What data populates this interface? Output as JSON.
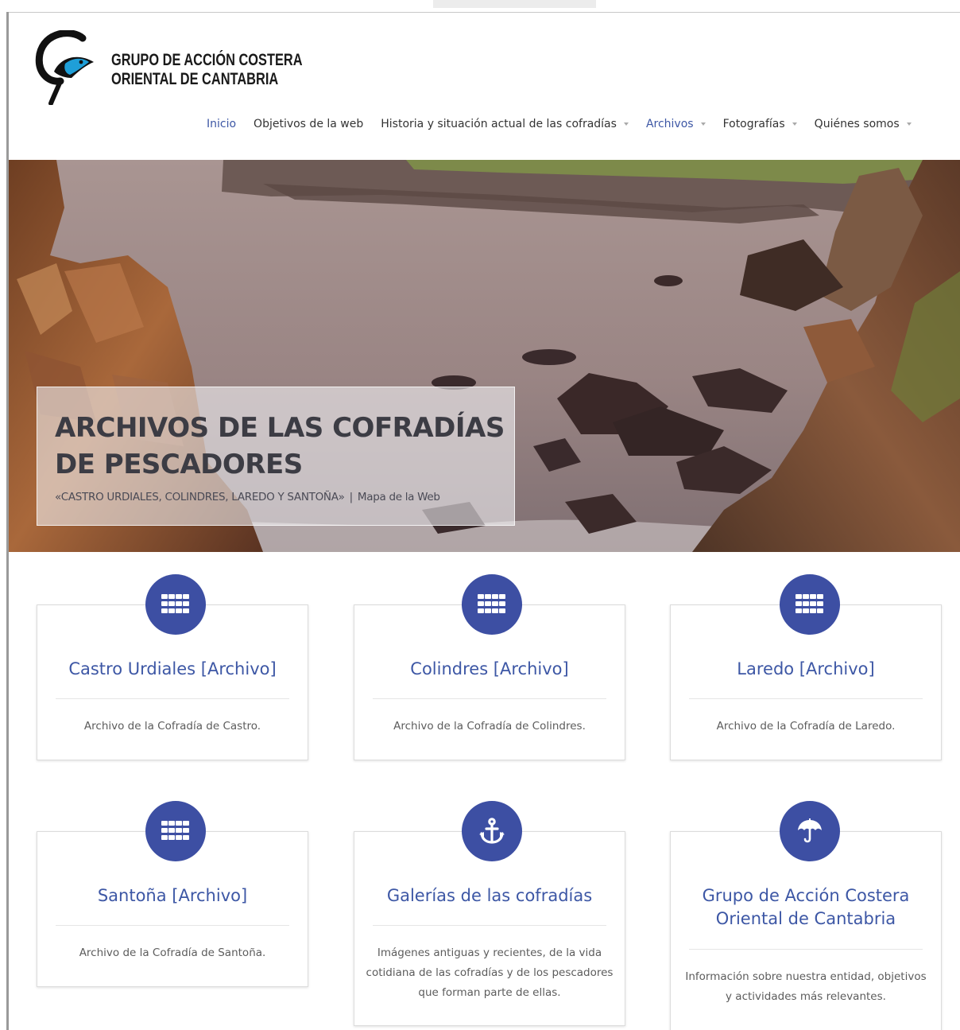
{
  "site": {
    "brand_line1": "GRUPO DE ACCIÓN COSTERA",
    "brand_line2": "ORIENTAL DE CANTABRIA",
    "logo_icon": "fish-logo-icon",
    "accent_color": "#3d57a5",
    "icon_bg_color": "#3d4fa3"
  },
  "nav": {
    "items": [
      {
        "label": "Inicio",
        "active": true,
        "dropdown": false
      },
      {
        "label": "Objetivos de la web",
        "active": false,
        "dropdown": false
      },
      {
        "label": "Historia y situación actual de las cofradías",
        "active": false,
        "dropdown": true
      },
      {
        "label": "Archivos",
        "active": true,
        "dropdown": true
      },
      {
        "label": "Fotografías",
        "active": false,
        "dropdown": true
      },
      {
        "label": "Quiénes somos",
        "active": false,
        "dropdown": true
      }
    ]
  },
  "hero": {
    "title": "ARCHIVOS DE LAS COFRADÍAS DE PESCADORES",
    "subtitle_quote": "«CASTRO URDIALES, COLINDRES, LAREDO Y SANTOÑA»",
    "separator": "|",
    "sitemap_link": "Mapa de la Web"
  },
  "cards": [
    {
      "icon": "grid-icon",
      "title": "Castro Urdiales [Archivo]",
      "text": "Archivo de la Cofradía de Castro."
    },
    {
      "icon": "grid-icon",
      "title": "Colindres [Archivo]",
      "text": "Archivo de la Cofradía de Colindres."
    },
    {
      "icon": "grid-icon",
      "title": "Laredo [Archivo]",
      "text": "Archivo de la Cofradía de Laredo."
    },
    {
      "icon": "grid-icon",
      "title": "Santoña [Archivo]",
      "text": "Archivo de la Cofradía de Santoña."
    },
    {
      "icon": "anchor-icon",
      "title": "Galerías de las cofradías",
      "text": "Imágenes antiguas y recientes, de la vida cotidiana de las cofradías y de los pescadores que forman parte de ellas."
    },
    {
      "icon": "umbrella-icon",
      "title": "Grupo de Acción Costera Oriental de Cantabria",
      "text": "Información sobre nuestra entidad, objetivos y actividades más relevantes."
    }
  ]
}
